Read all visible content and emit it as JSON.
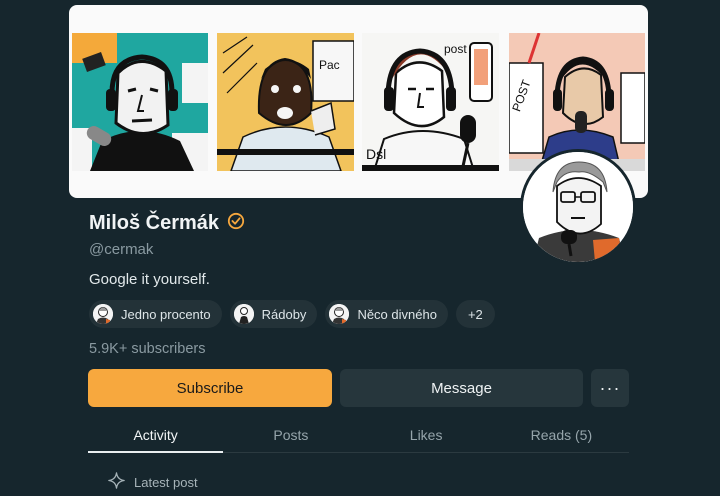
{
  "profile": {
    "name": "Miloš Čermák",
    "handle": "@cermak",
    "bio": "Google it yourself.",
    "subscribers": "5.9K+ subscribers",
    "verified": true
  },
  "publications": [
    {
      "label": "Jedno procento",
      "icon": "avatar-icon"
    },
    {
      "label": "Rádoby",
      "icon": "avatar-icon"
    },
    {
      "label": "Něco divného",
      "icon": "avatar-icon"
    }
  ],
  "more_publications": "+2",
  "actions": {
    "subscribe": "Subscribe",
    "message": "Message",
    "more": "···"
  },
  "tabs": [
    {
      "label": "Activity",
      "active": true
    },
    {
      "label": "Posts",
      "active": false
    },
    {
      "label": "Likes",
      "active": false
    },
    {
      "label": "Reads (5)",
      "active": false
    }
  ],
  "feed": {
    "latest_label": "Latest post",
    "icon": "sparkle-icon"
  },
  "banner_texts": {
    "panel2": "Pac",
    "panel3_sign": "Dsl",
    "panel3_word": "post",
    "panel4_word": "POST"
  },
  "colors": {
    "background": "#16262d",
    "accent": "#f7a83e",
    "verified": "#f7a83e",
    "muted_text": "#8a9aa1"
  }
}
